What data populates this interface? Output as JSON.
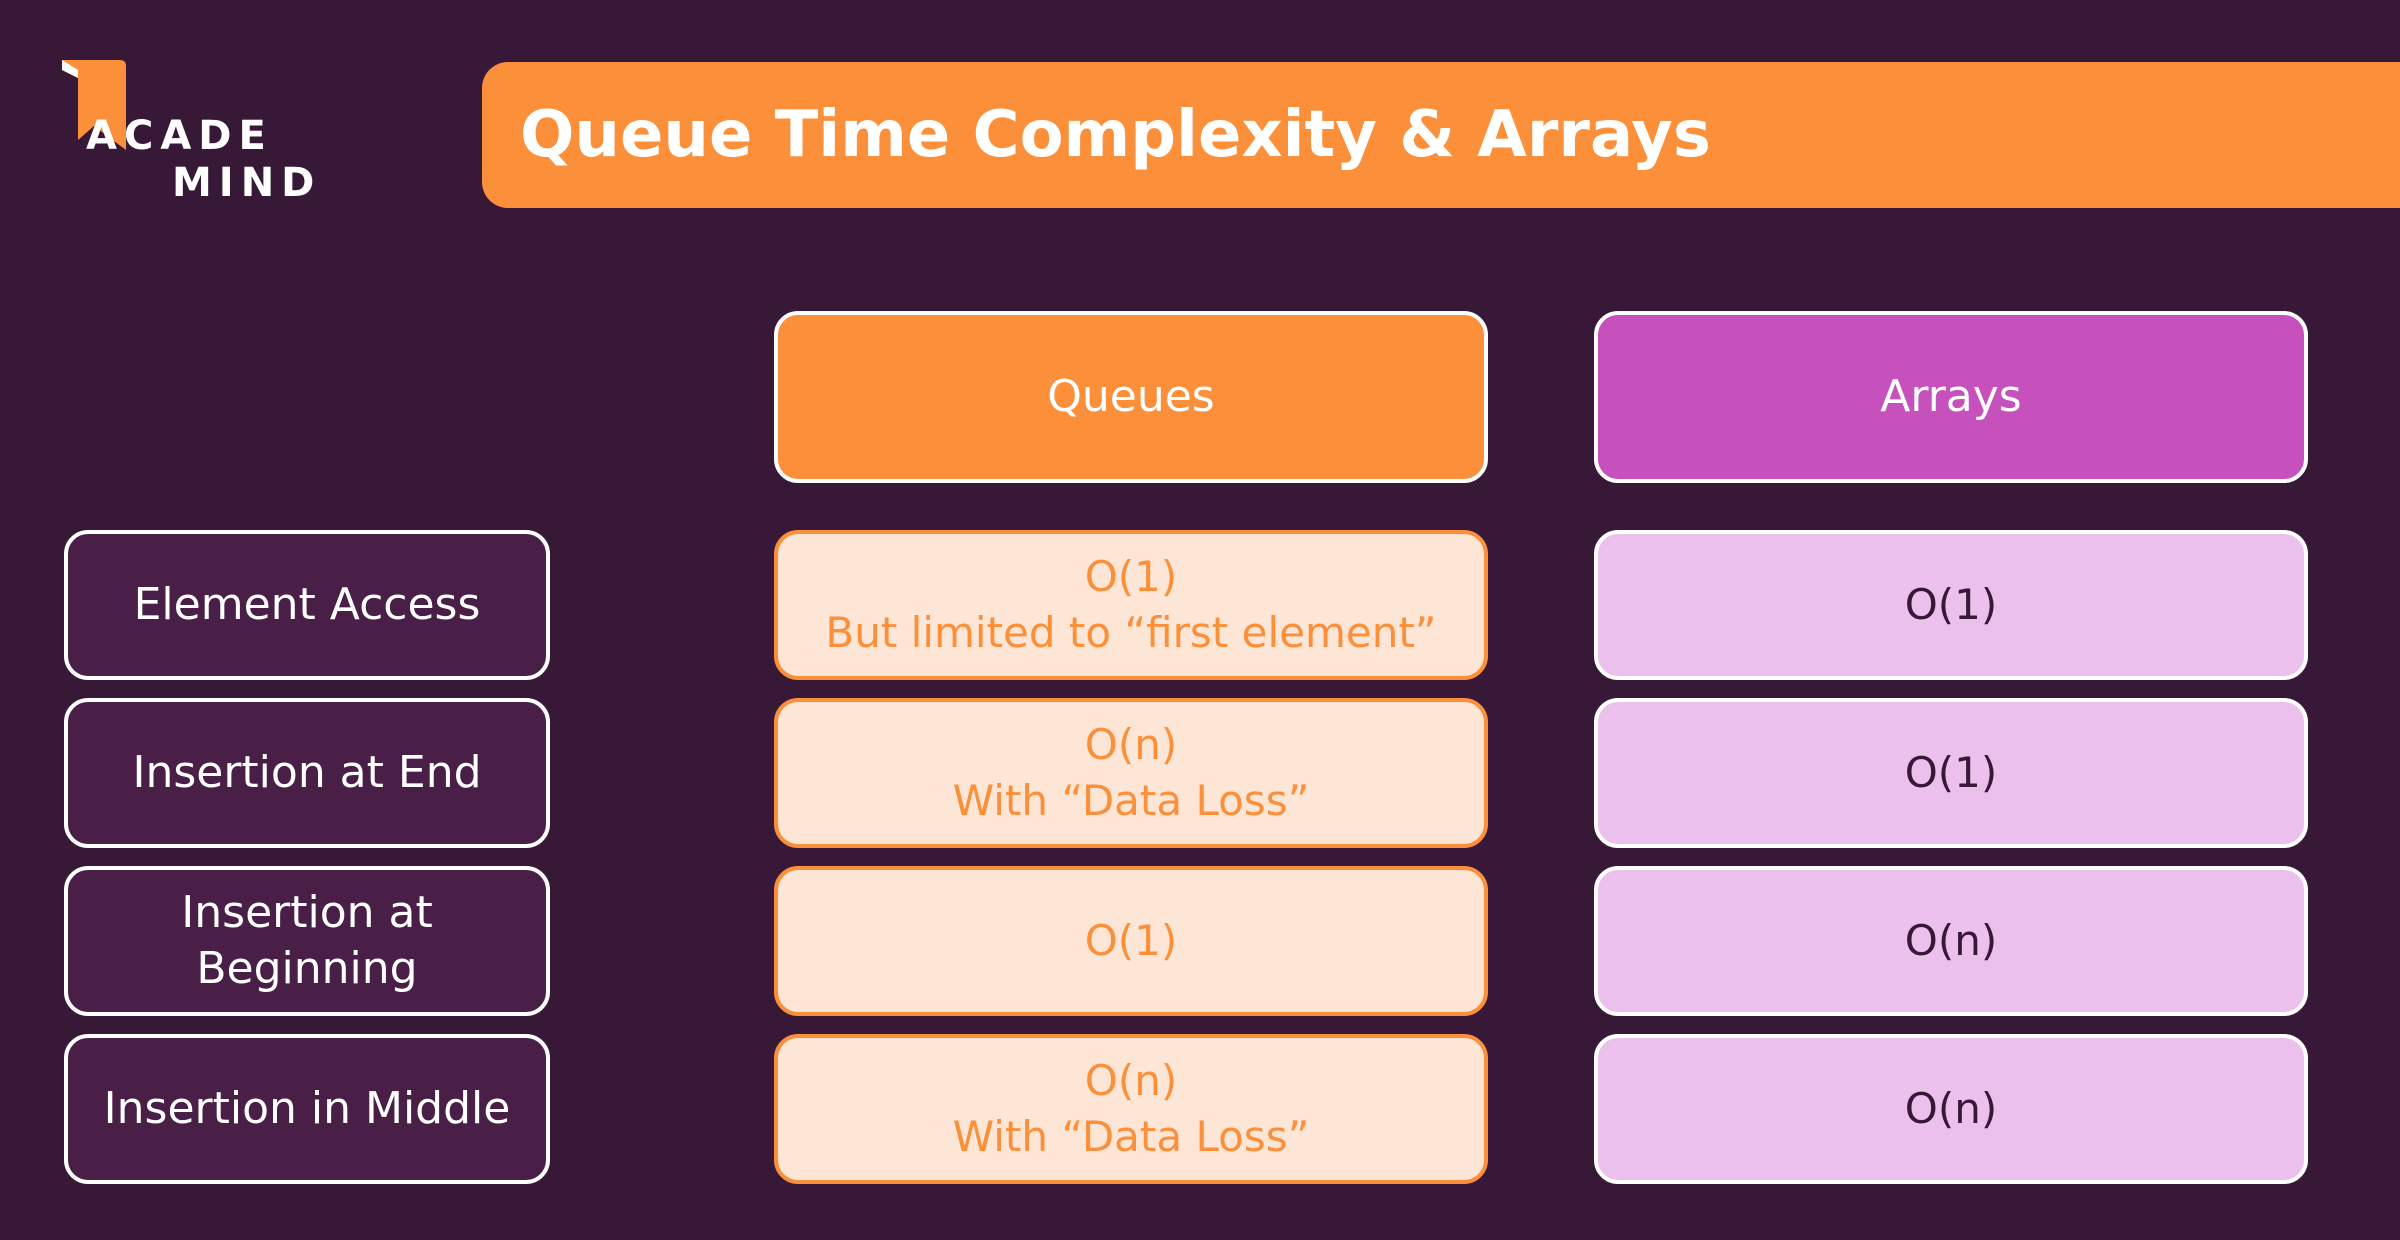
{
  "logo": {
    "line1": "ACADE",
    "line2": "MIND",
    "flag_color": "#fc8f3a"
  },
  "header": {
    "title": "Queue Time Complexity & Arrays"
  },
  "columns": {
    "queues": "Queues",
    "arrays": "Arrays"
  },
  "rows": [
    {
      "label": [
        "Element Access"
      ],
      "queues": [
        "O(1)",
        "But limited to “first element”"
      ],
      "arrays": [
        "O(1)"
      ]
    },
    {
      "label": [
        "Insertion at End"
      ],
      "queues": [
        "O(n)",
        "With “Data Loss”"
      ],
      "arrays": [
        "O(1)"
      ]
    },
    {
      "label": [
        "Insertion at",
        "Beginning"
      ],
      "queues": [
        "O(1)"
      ],
      "arrays": [
        "O(n)"
      ]
    },
    {
      "label": [
        "Insertion in Middle"
      ],
      "queues": [
        "O(n)",
        "With “Data Loss”"
      ],
      "arrays": [
        "O(n)"
      ]
    }
  ],
  "colors": {
    "background": "#371937",
    "accent_orange": "#fc8f3a",
    "accent_purple": "#c650bc",
    "queue_cell_bg": "#fde6d6",
    "array_cell_bg": "#ecc0ec",
    "label_cell_bg": "#4a1f47"
  }
}
